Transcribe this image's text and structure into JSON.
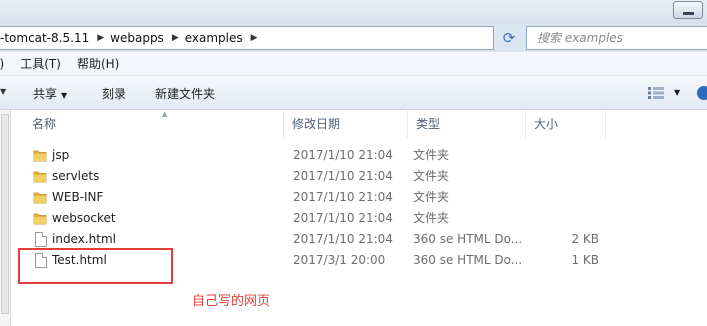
{
  "address": {
    "crumbs": [
      "-tomcat-8.5.11",
      "webapps",
      "examples"
    ],
    "search_placeholder": "搜索 examples"
  },
  "menu": [
    "I)",
    "工具(T)",
    "帮助(H)"
  ],
  "toolbar": {
    "share_label": "共享",
    "burn_label": "刻录",
    "new_folder_label": "新建文件夹"
  },
  "columns": {
    "name": "名称",
    "modified": "修改日期",
    "type": "类型",
    "size": "大小"
  },
  "files": [
    {
      "name": "jsp",
      "modified": "2017/1/10 21:04",
      "type": "文件夹",
      "size": "",
      "icon": "folder-icon"
    },
    {
      "name": "servlets",
      "modified": "2017/1/10 21:04",
      "type": "文件夹",
      "size": "",
      "icon": "folder-icon"
    },
    {
      "name": "WEB-INF",
      "modified": "2017/1/10 21:04",
      "type": "文件夹",
      "size": "",
      "icon": "folder-icon"
    },
    {
      "name": "websocket",
      "modified": "2017/1/10 21:04",
      "type": "文件夹",
      "size": "",
      "icon": "folder-icon"
    },
    {
      "name": "index.html",
      "modified": "2017/1/10 21:04",
      "type": "360 se HTML Do...",
      "size": "2 KB",
      "icon": "html-file-icon"
    },
    {
      "name": "Test.html",
      "modified": "2017/3/1 20:00",
      "type": "360 se HTML Do...",
      "size": "1 KB",
      "icon": "html-file-icon"
    }
  ],
  "annotation": "自己写的网页",
  "colors": {
    "accent": "#e0403a",
    "folder": "#e8b53c"
  }
}
